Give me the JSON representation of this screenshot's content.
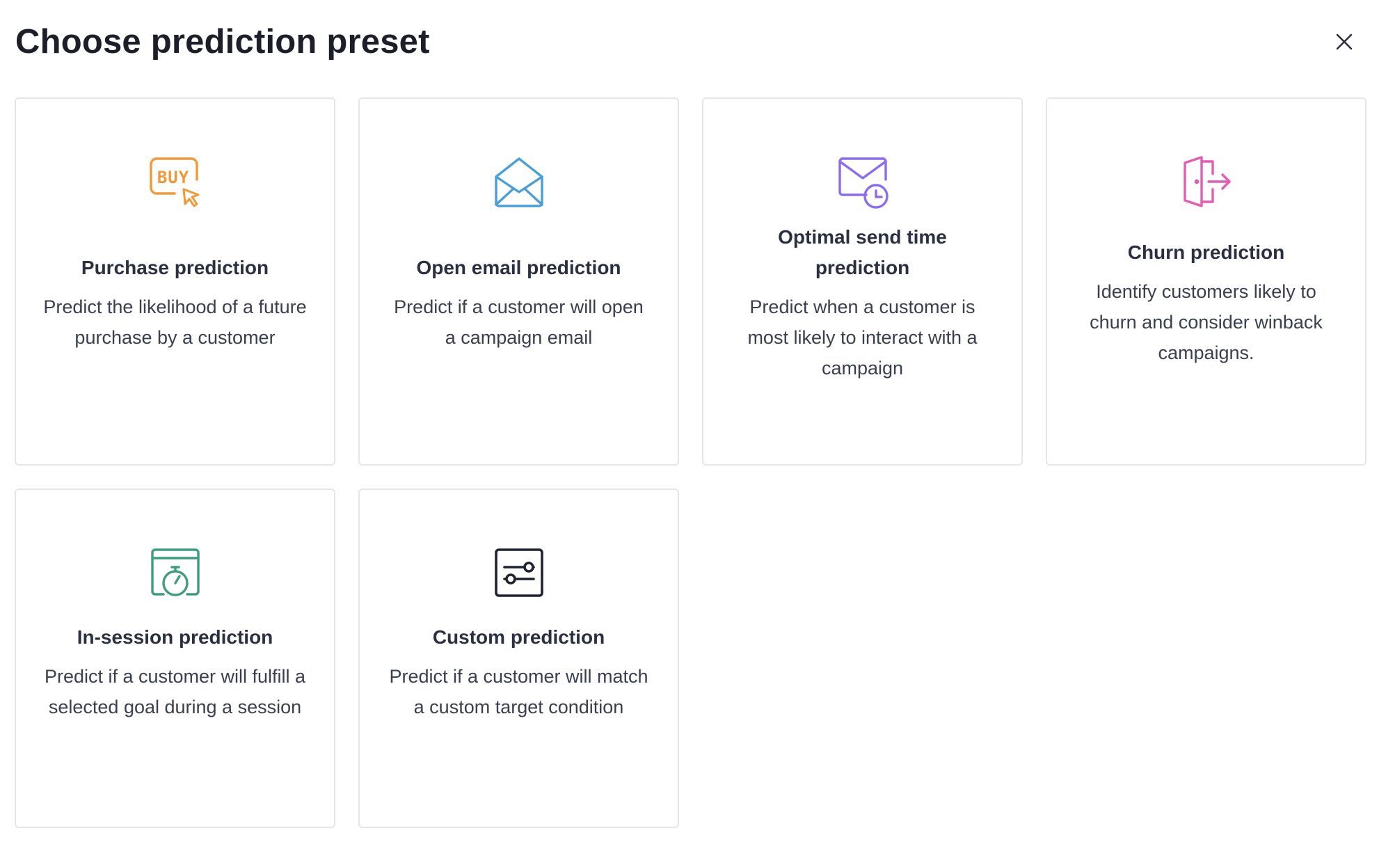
{
  "dialog": {
    "title": "Choose prediction preset",
    "close_icon": "close-icon"
  },
  "presets": [
    {
      "title": "Purchase prediction",
      "description": "Predict the likelihood of a future purchase by a customer",
      "icon": "buy-cursor-icon",
      "color": "#f0993b"
    },
    {
      "title": "Open email prediction",
      "description": "Predict if a customer will open a campaign email",
      "icon": "open-envelope-icon",
      "color": "#4b9fd6"
    },
    {
      "title": "Optimal send time prediction",
      "description": "Predict when a customer is most likely to interact with a campaign",
      "icon": "envelope-clock-icon",
      "color": "#8b6cf0"
    },
    {
      "title": "Churn prediction",
      "description": "Identify customers likely to churn and consider winback campaigns.",
      "icon": "door-exit-icon",
      "color": "#e35bb3"
    },
    {
      "title": "In-session prediction",
      "description": "Predict if a customer will fulfill a selected goal during a session",
      "icon": "browser-stopwatch-icon",
      "color": "#3f9d7e"
    },
    {
      "title": "Custom prediction",
      "description": "Predict if a customer will match a custom target condition",
      "icon": "sliders-icon",
      "color": "#1f2330"
    }
  ]
}
